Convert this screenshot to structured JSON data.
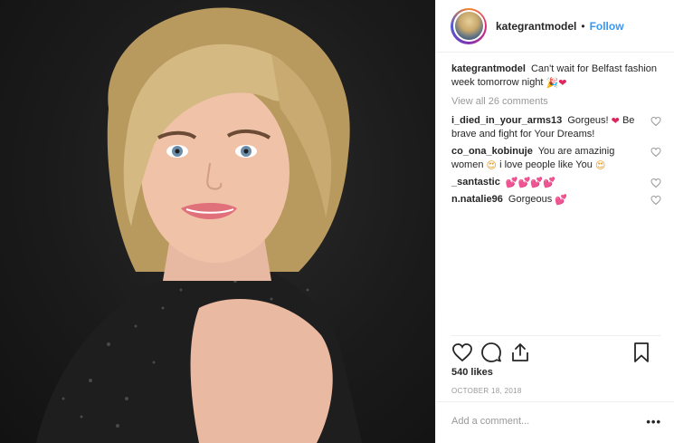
{
  "post": {
    "photo_alt": "portrait of a blonde woman in a black lace top"
  },
  "header": {
    "username": "kategrantmodel",
    "separator": "•",
    "follow_label": "Follow"
  },
  "caption": {
    "username": "kategrantmodel",
    "text": "Can't wait for Belfast fashion week tomorrow night",
    "emojis": [
      "🎉",
      "❤"
    ]
  },
  "view_all": "View all 26 comments",
  "comments": [
    {
      "username": "i_died_in_your_arms13",
      "text_before": "Gorgeus!",
      "emoji": "❤",
      "text_after": "Be brave and fight for Your Dreams!"
    },
    {
      "username": "co_ona_kobinuje",
      "text_before": "You are amazinig women",
      "emoji": "😍",
      "text_after": "i love people like You",
      "emoji2": "😍"
    },
    {
      "username": "_santastic",
      "text_before": "",
      "emoji": "💕💕💕💕",
      "text_after": ""
    },
    {
      "username": "n.natalie96",
      "text_before": "Gorgeous",
      "emoji": "💕",
      "text_after": ""
    }
  ],
  "likes": "540 likes",
  "date": "OCTOBER 18, 2018",
  "add_comment_placeholder": "Add a comment...",
  "more_label": "•••",
  "icons": [
    "heart-icon",
    "comment-icon",
    "share-icon",
    "bookmark-icon"
  ],
  "colors": {
    "link": "#3897f0",
    "muted": "#999999",
    "text": "#262626",
    "heart": "#e0245e"
  }
}
